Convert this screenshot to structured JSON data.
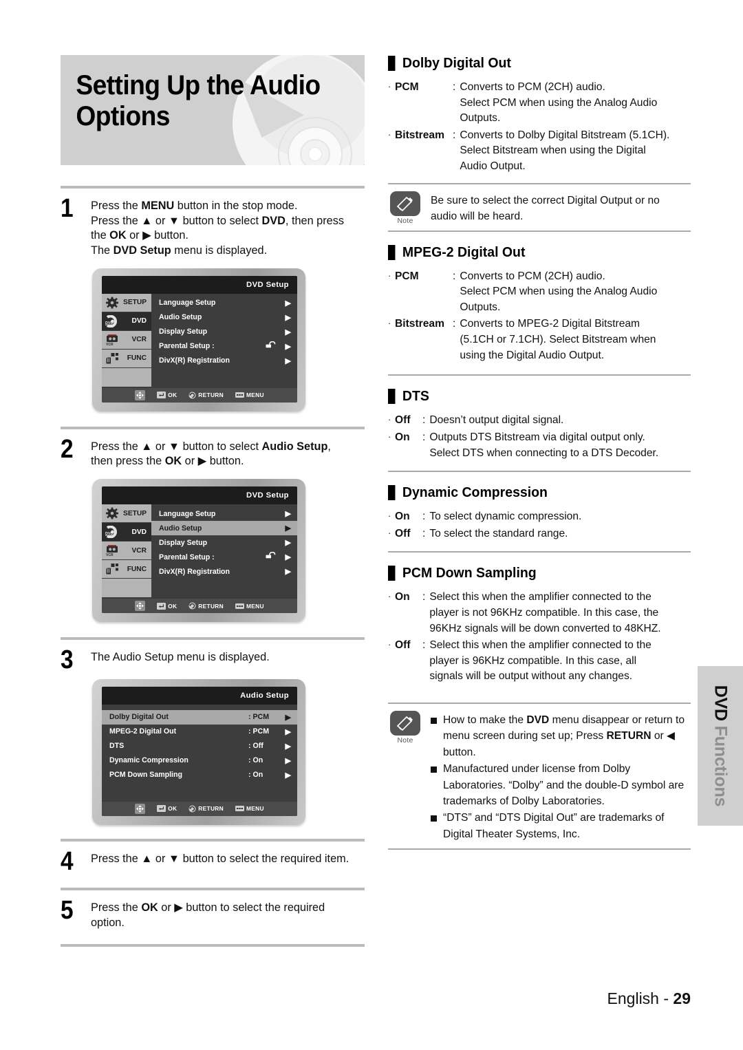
{
  "header": {
    "title": "Setting Up the Audio\nOptions",
    "disc_graphic": "dvd-disc-illustration"
  },
  "steps": [
    {
      "number": "1",
      "lines": [
        "Press the <b>MENU</b> button in the stop mode.",
        "Press the ▲ or ▼ button to select <b>DVD</b>, then press",
        "the <b>OK</b> or ▶ button.",
        "The <b>DVD Setup</b> menu is displayed."
      ]
    },
    {
      "number": "2",
      "lines": [
        "Press the ▲ or ▼ button to select <b>Audio Setup</b>,",
        "then press the <b>OK</b> or ▶ button."
      ]
    },
    {
      "number": "3",
      "lines": [
        "The Audio Setup menu is displayed."
      ]
    },
    {
      "number": "4",
      "lines": [
        "Press the ▲ or ▼ button to select the required item."
      ]
    },
    {
      "number": "5",
      "lines": [
        "Press the <b>OK</b> or ▶ button to select the required",
        "option."
      ]
    }
  ],
  "osd_dvd_setup_1": {
    "title": "DVD  Setup",
    "sidebar": [
      {
        "label": "SETUP",
        "icon": "gear-icon",
        "state": "lit"
      },
      {
        "label": "DVD",
        "icon": "disc-icon",
        "state": "sel"
      },
      {
        "label": "VCR",
        "icon": "tape-icon",
        "state": "lit"
      },
      {
        "label": "FUNC",
        "icon": "hand-icon",
        "state": "lit"
      }
    ],
    "rows": [
      {
        "label": "Language Setup",
        "value": "",
        "lock": false,
        "highlight": false,
        "arrow": "▶"
      },
      {
        "label": "Audio Setup",
        "value": "",
        "lock": false,
        "highlight": false,
        "arrow": "▶"
      },
      {
        "label": "Display Setup",
        "value": "",
        "lock": false,
        "highlight": false,
        "arrow": "▶"
      },
      {
        "label": "Parental Setup :",
        "value": "",
        "lock": true,
        "highlight": false,
        "arrow": "▶"
      },
      {
        "label": "DivX(R) Registration",
        "value": "",
        "lock": false,
        "highlight": false,
        "arrow": "▶"
      }
    ],
    "bar": [
      {
        "icon": "dpad-icon",
        "label": ""
      },
      {
        "icon": "enter-icon",
        "label": "OK"
      },
      {
        "icon": "return-icon",
        "label": "RETURN"
      },
      {
        "icon": "menu-icon",
        "label": "MENU"
      }
    ]
  },
  "osd_dvd_setup_2": {
    "title": "DVD  Setup",
    "sidebar": [
      {
        "label": "SETUP",
        "icon": "gear-icon",
        "state": "lit"
      },
      {
        "label": "DVD",
        "icon": "disc-icon",
        "state": "sel"
      },
      {
        "label": "VCR",
        "icon": "tape-icon",
        "state": "lit"
      },
      {
        "label": "FUNC",
        "icon": "hand-icon",
        "state": "lit"
      }
    ],
    "rows": [
      {
        "label": "Language Setup",
        "value": "",
        "lock": false,
        "highlight": false,
        "arrow": "▶"
      },
      {
        "label": "Audio Setup",
        "value": "",
        "lock": false,
        "highlight": true,
        "arrow": "▶"
      },
      {
        "label": "Display Setup",
        "value": "",
        "lock": false,
        "highlight": false,
        "arrow": "▶"
      },
      {
        "label": "Parental Setup :",
        "value": "",
        "lock": true,
        "highlight": false,
        "arrow": "▶"
      },
      {
        "label": "DivX(R) Registration",
        "value": "",
        "lock": false,
        "highlight": false,
        "arrow": "▶"
      }
    ],
    "bar": [
      {
        "icon": "dpad-icon",
        "label": ""
      },
      {
        "icon": "enter-icon",
        "label": "OK"
      },
      {
        "icon": "return-icon",
        "label": "RETURN"
      },
      {
        "icon": "menu-icon",
        "label": "MENU"
      }
    ]
  },
  "osd_audio_setup": {
    "title": "Audio Setup",
    "rows": [
      {
        "label": "Dolby Digital Out",
        "value": ": PCM",
        "highlight": true,
        "arrow": "▶"
      },
      {
        "label": "MPEG-2 Digital Out",
        "value": ": PCM",
        "highlight": false,
        "arrow": "▶"
      },
      {
        "label": "DTS",
        "value": ": Off",
        "highlight": false,
        "arrow": "▶"
      },
      {
        "label": "Dynamic Compression",
        "value": ": On",
        "highlight": false,
        "arrow": "▶"
      },
      {
        "label": "PCM Down Sampling",
        "value": ": On",
        "highlight": false,
        "arrow": "▶"
      }
    ],
    "bar": [
      {
        "icon": "dpad-icon",
        "label": ""
      },
      {
        "icon": "enter-icon",
        "label": "OK"
      },
      {
        "icon": "return-icon",
        "label": "RETURN"
      },
      {
        "icon": "menu-icon",
        "label": "MENU"
      }
    ]
  },
  "sections": [
    {
      "id": "dolby-digital-out",
      "heading": "Dolby Digital Out",
      "items": [
        {
          "term": "PCM",
          "desc": "Converts to PCM (2CH) audio.\nSelect PCM when using the Analog Audio\nOutputs."
        },
        {
          "term": "Bitstream",
          "desc": "Converts to Dolby Digital Bitstream (5.1CH).\nSelect Bitstream when using the Digital\nAudio Output."
        }
      ]
    },
    {
      "id": "mpeg2-digital-out",
      "heading": "MPEG-2 Digital Out",
      "items": [
        {
          "term": "PCM",
          "desc": "Converts to PCM (2CH) audio.\nSelect PCM when using the Analog  Audio\nOutputs."
        },
        {
          "term": "Bitstream",
          "desc": "Converts to MPEG-2 Digital Bitstream\n(5.1CH or 7.1CH). Select Bitstream when\nusing the Digital Audio Output."
        }
      ]
    },
    {
      "id": "dts",
      "heading": "DTS",
      "items": [
        {
          "term": "Off",
          "desc": "Doesn’t output digital signal."
        },
        {
          "term": "On",
          "desc": "Outputs DTS Bitstream via digital output only.\nSelect DTS when connecting to a DTS Decoder."
        }
      ]
    },
    {
      "id": "dynamic-compression",
      "heading": "Dynamic Compression",
      "items": [
        {
          "term": "On",
          "desc": "To select dynamic compression."
        },
        {
          "term": "Off",
          "desc": "To select the standard range."
        }
      ]
    },
    {
      "id": "pcm-down-sampling",
      "heading": "PCM Down Sampling",
      "items": [
        {
          "term": "On",
          "desc": "Select this when the amplifier connected to the\nplayer is not 96KHz compatible. In this case, the\n96KHz signals will be down converted to 48KHZ."
        },
        {
          "term": "Off",
          "desc": "Select this when the amplifier connected to the\nplayer is 96KHz compatible. In this case, all\nsignals will be output without any changes."
        }
      ]
    }
  ],
  "note_top": {
    "caption": "Note",
    "text": "Be sure to select the correct Digital Output or no\naudio will be heard."
  },
  "note_bottom": {
    "caption": "Note",
    "bullets": [
      "How to make the <b>DVD</b> menu disappear or return to menu screen during set up; Press <b>RETURN</b> or ◀ button.",
      "Manufactured under license from Dolby Laboratories. “Dolby” and the double-D symbol are trademarks of Dolby Laboratories.",
      "“DTS” and “DTS Digital Out” are trademarks of Digital Theater Systems, Inc."
    ]
  },
  "side_tab": {
    "bold_part": "DVD",
    "light_part": " Functions"
  },
  "footer": {
    "language": "English - ",
    "page": "29"
  },
  "colors": {
    "banner_bg": "#cfcfcf",
    "rule": "#bbbbbb",
    "osd_bg": "#3d3d3d",
    "osd_title_bg": "#1c1c1c",
    "osd_highlight": "#a9a9a9",
    "note_icon_bg": "#555555",
    "side_tab_bg": "#cfcfcf"
  }
}
